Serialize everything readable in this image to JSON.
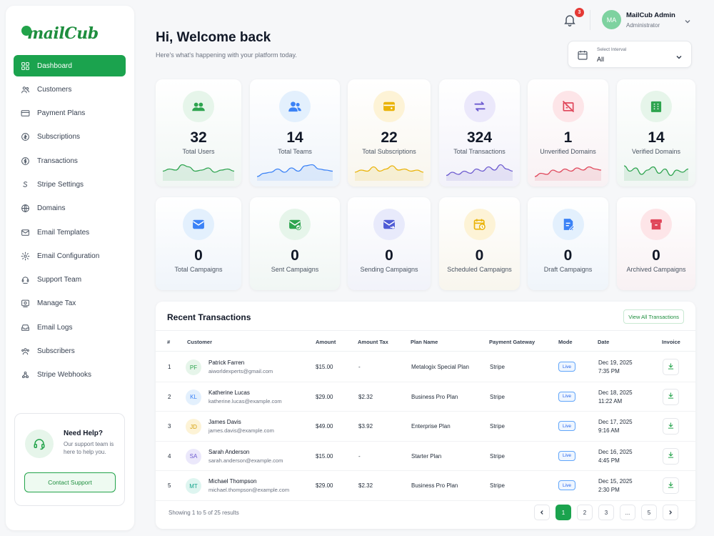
{
  "brand": {
    "name": "mailCub"
  },
  "sidebar": {
    "items": [
      {
        "label": "Dashboard",
        "icon": "grid-icon",
        "active": true
      },
      {
        "label": "Customers",
        "icon": "users-icon"
      },
      {
        "label": "Payment Plans",
        "icon": "card-icon"
      },
      {
        "label": "Subscriptions",
        "icon": "subscription-icon"
      },
      {
        "label": "Transactions",
        "icon": "dollar-icon"
      },
      {
        "label": "Stripe Settings",
        "icon": "stripe-icon"
      },
      {
        "label": "Domains",
        "icon": "globe-icon"
      },
      {
        "label": "Email Templates",
        "icon": "mail-icon"
      },
      {
        "label": "Email Configuration",
        "icon": "gear-icon"
      },
      {
        "label": "Support Team",
        "icon": "support-icon"
      },
      {
        "label": "Manage Tax",
        "icon": "tax-icon"
      },
      {
        "label": "Email Logs",
        "icon": "inbox-icon"
      },
      {
        "label": "Subscribers",
        "icon": "subscribers-icon"
      },
      {
        "label": "Stripe Webhooks",
        "icon": "webhook-icon"
      }
    ],
    "help": {
      "title": "Need Help?",
      "desc": "Our support team is here to help you.",
      "button": "Contact Support"
    }
  },
  "header": {
    "notifications": "3",
    "user_initials": "MA",
    "user_name": "MailCub Admin",
    "user_role": "Administrator"
  },
  "page": {
    "title": "Hi, Welcome back",
    "subtitle": "Here's what's happening with your platform today."
  },
  "interval": {
    "label": "Select Interval",
    "value": "All"
  },
  "stats_top": [
    {
      "value": "32",
      "label": "Total Users",
      "color": "#2ea44f",
      "bg": "#e6f5ea",
      "icon": "users-icon"
    },
    {
      "value": "14",
      "label": "Total Teams",
      "color": "#3b82f6",
      "bg": "#e3f0fd",
      "icon": "team-icon"
    },
    {
      "value": "22",
      "label": "Total Subscriptions",
      "color": "#eab308",
      "bg": "#fdf3d6",
      "icon": "subscription-icon"
    },
    {
      "value": "324",
      "label": "Total Transactions",
      "color": "#6d5bd0",
      "bg": "#ebe8fb",
      "icon": "transfer-icon"
    },
    {
      "value": "1",
      "label": "Unverified Domains",
      "color": "#e0465a",
      "bg": "#fde5e8",
      "icon": "unverified-icon"
    },
    {
      "value": "14",
      "label": "Verified Domains",
      "color": "#2ea44f",
      "bg": "#e6f5ea",
      "icon": "building-icon"
    }
  ],
  "stats_bottom": [
    {
      "value": "0",
      "label": "Total Campaigns",
      "color": "#3b82f6",
      "bg": "#e3f0fd",
      "icon": "mail-icon"
    },
    {
      "value": "0",
      "label": "Sent Campaigns",
      "color": "#2ea44f",
      "bg": "#e6f5ea",
      "icon": "mail-check-icon"
    },
    {
      "value": "0",
      "label": "Sending Campaigns",
      "color": "#4f5bd5",
      "bg": "#e8eafb",
      "icon": "mail-send-icon"
    },
    {
      "value": "0",
      "label": "Scheduled Campaigns",
      "color": "#eab308",
      "bg": "#fdf3d6",
      "icon": "calendar-clock-icon"
    },
    {
      "value": "0",
      "label": "Draft Campaigns",
      "color": "#3b82f6",
      "bg": "#e3f0fd",
      "icon": "draft-icon"
    },
    {
      "value": "0",
      "label": "Archived Campaigns",
      "color": "#e0465a",
      "bg": "#fde5e8",
      "icon": "archive-icon"
    }
  ],
  "transactions": {
    "title": "Recent Transactions",
    "view_all": "View All Transactions",
    "columns": [
      "#",
      "Customer",
      "Amount",
      "Amount Tax",
      "Plan Name",
      "Payment Gateway",
      "Mode",
      "Date",
      "Invoice"
    ],
    "rows": [
      {
        "n": "1",
        "initials": "PF",
        "name": "Patrick Farren",
        "email": "aiworldexperts@gmail.com",
        "amount": "$15.00",
        "tax": "-",
        "plan": "Metalogix Special Plan",
        "gateway": "Stripe",
        "mode": "Live",
        "date": "Dec 19, 2025",
        "time": "7:35 PM",
        "color": "#2ea44f",
        "bg": "#e6f5ea"
      },
      {
        "n": "2",
        "initials": "KL",
        "name": "Katherine Lucas",
        "email": "katherine.lucas@example.com",
        "amount": "$29.00",
        "tax": "$2.32",
        "plan": "Business Pro Plan",
        "gateway": "Stripe",
        "mode": "Live",
        "date": "Dec 18, 2025",
        "time": "11:22 AM",
        "color": "#3b82f6",
        "bg": "#e3f0fd"
      },
      {
        "n": "3",
        "initials": "JD",
        "name": "James Davis",
        "email": "james.davis@example.com",
        "amount": "$49.00",
        "tax": "$3.92",
        "plan": "Enterprise Plan",
        "gateway": "Stripe",
        "mode": "Live",
        "date": "Dec 17, 2025",
        "time": "9:16 AM",
        "color": "#d4a00a",
        "bg": "#fdf3d6"
      },
      {
        "n": "4",
        "initials": "SA",
        "name": "Sarah Anderson",
        "email": "sarah.anderson@example.com",
        "amount": "$15.00",
        "tax": "-",
        "plan": "Starter Plan",
        "gateway": "Stripe",
        "mode": "Live",
        "date": "Dec 16, 2025",
        "time": "4:45 PM",
        "color": "#6d5bd0",
        "bg": "#ebe8fb"
      },
      {
        "n": "5",
        "initials": "MT",
        "name": "Michael Thompson",
        "email": "michael.thompson@example.com",
        "amount": "$29.00",
        "tax": "$2.32",
        "plan": "Business Pro Plan",
        "gateway": "Stripe",
        "mode": "Live",
        "date": "Dec 15, 2025",
        "time": "2:30 PM",
        "color": "#14a38b",
        "bg": "#def5f0"
      }
    ],
    "footer": "Showing 1 to 5 of 25 results",
    "pages": [
      "1",
      "2",
      "3",
      "...",
      "5"
    ],
    "current_page": "1"
  }
}
